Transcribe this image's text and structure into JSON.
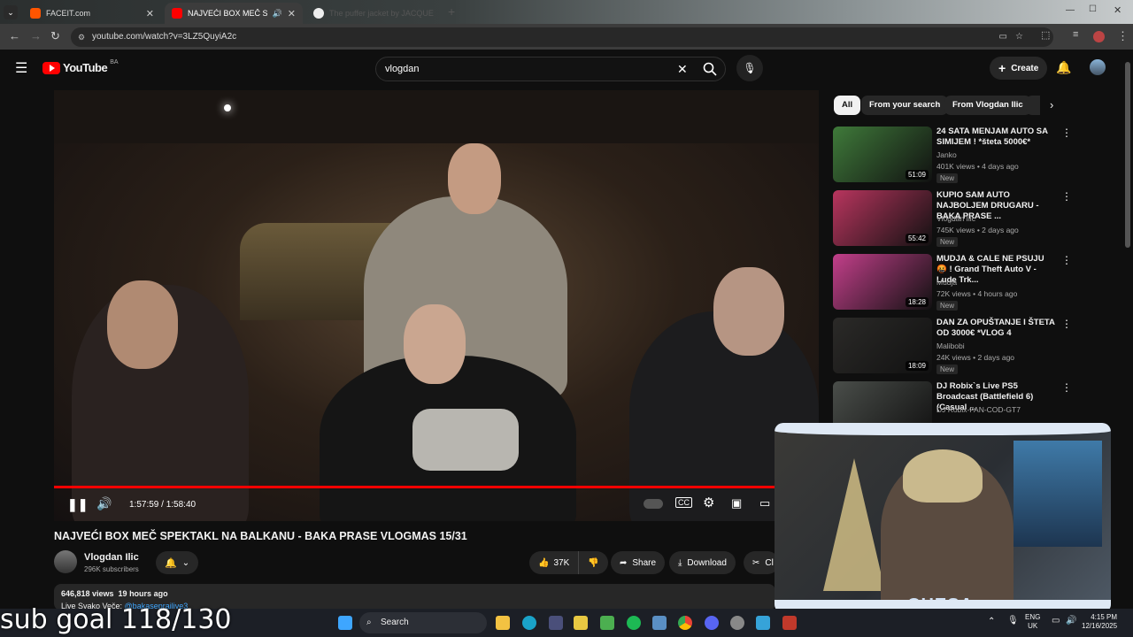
{
  "browser": {
    "tabs": [
      {
        "title": "FACEIT.com",
        "active": false
      },
      {
        "title": "NAJVEĆI BOX MEČ SPEKTAKL",
        "active": true
      },
      {
        "title": "The puffer jacket by JACQUE",
        "active": false
      }
    ],
    "url": "youtube.com/watch?v=3LZ5QuyiA2c"
  },
  "youtube": {
    "logo": "YouTube",
    "country": "BA",
    "search_value": "vlogdan",
    "create_label": "Create"
  },
  "video": {
    "time": "1:57:59 / 1:58:40",
    "progress": 0.995,
    "title": "NAJVEĆI BOX MEČ SPEKTAKL NA BALKANU - BAKA PRASE VLOGMAS 15/31",
    "channel": "Vlogdan Ilic",
    "subscribers": "296K subscribers",
    "likes": "37K",
    "share_label": "Share",
    "download_label": "Download",
    "clip_label": "Cl",
    "views": "646,818 views  19 hours ago",
    "desc_prefix": "Live Svako Veče: ",
    "desc_link": "@bakaseprailive3"
  },
  "sidebar": {
    "chips": [
      "All",
      "From your search",
      "From Vlogdan Ilic"
    ],
    "items": [
      {
        "title": "24 SATA MENJAM AUTO SA SIMIJEM ! *šteta 5000€*",
        "channel": "Janko",
        "meta": "401K views • 4 days ago",
        "duration": "51:09",
        "new": "New",
        "thumb": "#3f7a3a"
      },
      {
        "title": "KUPIO SAM AUTO NAJBOLJEM DRUGARU - BAKA PRASE ...",
        "channel": "Vlogdan Ilic",
        "meta": "745K views • 2 days ago",
        "duration": "55:42",
        "new": "New",
        "thumb": "#b8355e"
      },
      {
        "title": "MUDJA & CALE NE PSUJU 🤬 ! Grand Theft Auto V - Lude Trk...",
        "channel": "Mudja",
        "meta": "72K views • 4 hours ago",
        "duration": "18:28",
        "new": "New",
        "thumb": "#c23f8a"
      },
      {
        "title": "DAN ZA OPUŠTANJE I ŠTETA OD 3000€ *VLOG 4",
        "channel": "Malibobi",
        "meta": "24K views • 2 days ago",
        "duration": "18:09",
        "new": "New",
        "thumb": "#2b2a28"
      },
      {
        "title": "DJ Robix`s Live PS5 Broadcast (Battlefield 6)(Casual ...",
        "channel": "DJ Robix-FAN-COD-GT7",
        "meta": "",
        "duration": "",
        "new": "",
        "thumb": "#4a4e4a"
      }
    ]
  },
  "overlay": {
    "webcam_name": "CHESA",
    "subgoal": "sub goal 118/130"
  },
  "taskbar": {
    "search_label": "Search",
    "lang1": "ENG",
    "lang2": "UK",
    "time": "4:15 PM",
    "date": "12/16/2025"
  }
}
